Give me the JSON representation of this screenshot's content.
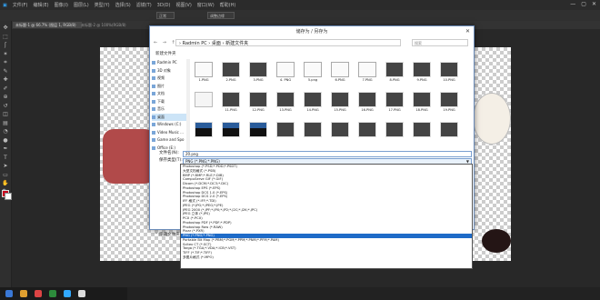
{
  "ps": {
    "menu": [
      "文件(F)",
      "编辑(E)",
      "图像(I)",
      "图层(L)",
      "类型(Y)",
      "选择(S)",
      "滤镜(T)",
      "3D(D)",
      "视图(V)",
      "窗口(W)",
      "帮助(H)"
    ],
    "window_buttons": [
      "—",
      "▢",
      "✕"
    ],
    "option_buttons": [
      "正常",
      "调整边缘"
    ],
    "tabs": [
      "未标题-1 @ 66.7% (图层 1, RGB/8)",
      "未标题-2 @ 100%(RGB/8)"
    ],
    "tools": [
      "move",
      "marquee",
      "lasso",
      "wand",
      "crop",
      "eyedropper",
      "heal",
      "brush",
      "stamp",
      "history",
      "eraser",
      "gradient",
      "blur",
      "dodge",
      "pen",
      "type",
      "path",
      "shape",
      "hand",
      "zoom"
    ],
    "colors": {
      "foreground": "#c8001e",
      "background": "#ffffff",
      "canvas_shape": "#b14a4a"
    }
  },
  "dialog": {
    "title": "储存为 / 另存为",
    "close": "✕",
    "nav_arrows": "←  →  ↑",
    "breadcrumb": "› Radmin PC › 桌面 › 新建文件夹",
    "search_placeholder": "搜索",
    "toolbar": "新建文件夹",
    "nav_items": [
      {
        "label": "Radmin PC",
        "selected": false
      },
      {
        "label": "3D 对象",
        "selected": false
      },
      {
        "label": "视频",
        "selected": false
      },
      {
        "label": "图片",
        "selected": false
      },
      {
        "label": "文档",
        "selected": false
      },
      {
        "label": "下载",
        "selected": false
      },
      {
        "label": "音乐",
        "selected": false
      },
      {
        "label": "桌面",
        "selected": true
      },
      {
        "label": "Windows (C:)",
        "selected": false
      },
      {
        "label": "Video Music ...",
        "selected": false
      },
      {
        "label": "Game and Spo",
        "selected": false
      },
      {
        "label": "Office (E:)",
        "selected": false
      }
    ],
    "thumbnails": [
      {
        "name": "1.PNG",
        "style": "white"
      },
      {
        "name": "2.PNG",
        "style": "dark"
      },
      {
        "name": "3.PNG",
        "style": "dark"
      },
      {
        "name": "4. PNG",
        "style": "white"
      },
      {
        "name": "5.png",
        "style": "white"
      },
      {
        "name": "6.PNG",
        "style": "white"
      },
      {
        "name": "7.PNG",
        "style": "white"
      },
      {
        "name": "8.PNG",
        "style": "dark"
      },
      {
        "name": "9.PNG",
        "style": "dark"
      },
      {
        "name": "10.PNG",
        "style": "dark"
      },
      {
        "name": "",
        "style": "blank"
      },
      {
        "name": "11.PNG",
        "style": "dark"
      },
      {
        "name": "12.PNG",
        "style": "dark"
      },
      {
        "name": "13.PNG",
        "style": "dark"
      },
      {
        "name": "14.PNG",
        "style": "dark"
      },
      {
        "name": "15.PNG",
        "style": "dark"
      },
      {
        "name": "16.PNG",
        "style": "dark"
      },
      {
        "name": "17.PNG",
        "style": "dark"
      },
      {
        "name": "18.PNG",
        "style": "dark"
      },
      {
        "name": "19.PNG",
        "style": "dark"
      },
      {
        "name": "",
        "style": "blue"
      },
      {
        "name": "",
        "style": "blue"
      },
      {
        "name": "",
        "style": "blue"
      },
      {
        "name": "",
        "style": "dark"
      },
      {
        "name": "",
        "style": "dark"
      },
      {
        "name": "",
        "style": "dark"
      },
      {
        "name": "",
        "style": "dark"
      },
      {
        "name": "",
        "style": "dark"
      },
      {
        "name": "",
        "style": "dark"
      },
      {
        "name": "",
        "style": "dark"
      }
    ],
    "filename_label": "文件名(N):",
    "filename_value": "20.png",
    "filetype_label": "保存类型(T):",
    "filetype_value": "PNG (*.PNG;*.PNG)",
    "hide_folders": "^ 隐藏文件夹"
  },
  "format_list": {
    "options": [
      "Photoshop (*.PSD;*.PDD;*.PSDT)",
      "大型文档格式 (*.PSB)",
      "BMP (*.BMP;*.RLE;*.DIB)",
      "CompuServe GIF (*.GIF)",
      "Dicom (*.DCM;*.DC3;*.DIC)",
      "Photoshop EPS (*.EPS)",
      "Photoshop DCS 1.0 (*.EPS)",
      "Photoshop DCS 2.0 (*.EPS)",
      "IFF 格式 (*.IFF;*.TDI)",
      "JPEG (*.JPG;*.JPEG;*.JPE)",
      "JPEG 2000 (*.JPF;*.JPX;*.JP2;*.J2C;*.J2K;*.JPC)",
      "JPEG 立体 (*.JPS)",
      "PCX (*.PCX)",
      "Photoshop PDF (*.PDF;*.PDP)",
      "Photoshop Raw (*.RAW)",
      "Pixar (*.PXR)",
      "PNG (*.PNG;*.PNG)",
      "Portable Bit Map (*.PBM;*.PGM;*.PPM;*.PNM;*.PFM;*.PAM)",
      "Scitex CT (*.SCT)",
      "Targa (*.TGA;*.VDA;*.ICB;*.VST)",
      "TIFF (*.TIF;*.TIFF)",
      "多图片格式 (*.MPO)"
    ],
    "selected_index": 16
  },
  "taskbar": {
    "colors": [
      "#3a78d6",
      "#e0a030",
      "#d44",
      "#2d8c3c",
      "#31a8ff",
      "#ddd"
    ]
  }
}
